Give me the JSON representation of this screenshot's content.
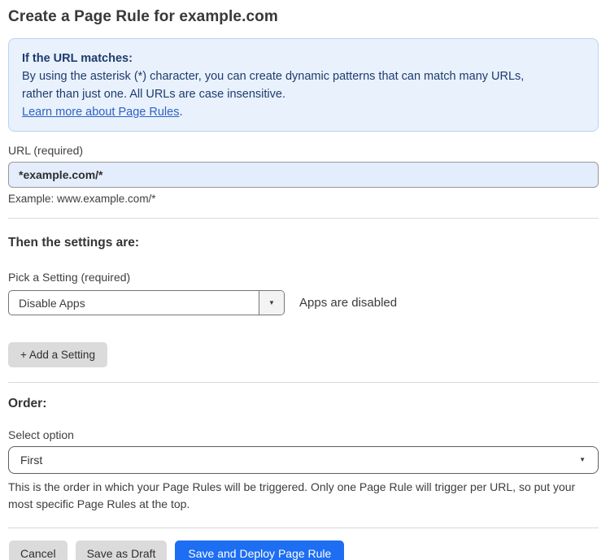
{
  "page": {
    "title": "Create a Page Rule for example.com"
  },
  "info_box": {
    "heading": "If the URL matches:",
    "body_lines": [
      "By using the asterisk (*) character, you can create dynamic patterns that can match many URLs,",
      "rather than just one. All URLs are case insensitive."
    ],
    "link_text": "Learn more about Page Rules",
    "link_suffix": "."
  },
  "url_field": {
    "label": "URL (required)",
    "value": "*example.com/*",
    "helper": "Example: www.example.com/*"
  },
  "settings": {
    "heading": "Then the settings are:",
    "picker_label": "Pick a Setting (required)",
    "selected_setting": "Disable Apps",
    "status_text": "Apps are disabled",
    "add_button_label": "+ Add a Setting"
  },
  "order": {
    "heading": "Order:",
    "select_label": "Select option",
    "selected_option": "First",
    "helper": "This is the order in which your Page Rules will be triggered. Only one Page Rule will trigger per URL, so put your most specific Page Rules at the top."
  },
  "footer": {
    "cancel_label": "Cancel",
    "save_draft_label": "Save as Draft",
    "save_deploy_label": "Save and Deploy Page Rule"
  },
  "icons": {
    "dropdown_caret": "▼"
  },
  "colors": {
    "info_bg": "#e9f1fc",
    "info_border": "#b8d4f1",
    "info_text": "#1d3c6e",
    "link": "#2c62c4",
    "input_bg": "#e4edfb",
    "primary_button": "#1d6ef2",
    "gray_button": "#dbdbdb"
  }
}
